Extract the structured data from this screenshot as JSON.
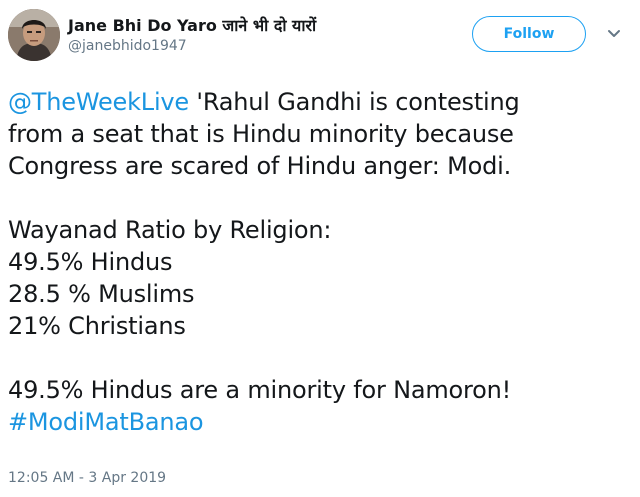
{
  "user": {
    "display_name": "Jane Bhi Do Yaro जाने भी दो यारों",
    "handle": "@janebhido1947"
  },
  "follow_button": {
    "label": "Follow"
  },
  "tweet": {
    "line1": {
      "mention": "@TheWeekLive",
      "text": " 'Rahul Gandhi is contesting"
    },
    "line2": "from a seat that is Hindu minority because",
    "line3": "Congress are scared of Hindu anger: Modi.",
    "line4": "Wayanad Ratio by Religion:",
    "line5": "49.5% Hindus",
    "line6": "28.5 % Muslims",
    "line7": "21% Christians",
    "line8": "49.5% Hindus are a minority for Namoron!",
    "hashtag": "#ModiMatBanao"
  },
  "timestamp": "12:05 AM - 3 Apr 2019",
  "colors": {
    "link": "#1b95e0",
    "follow_accent": "#1da1f2",
    "secondary_text": "#657786"
  }
}
